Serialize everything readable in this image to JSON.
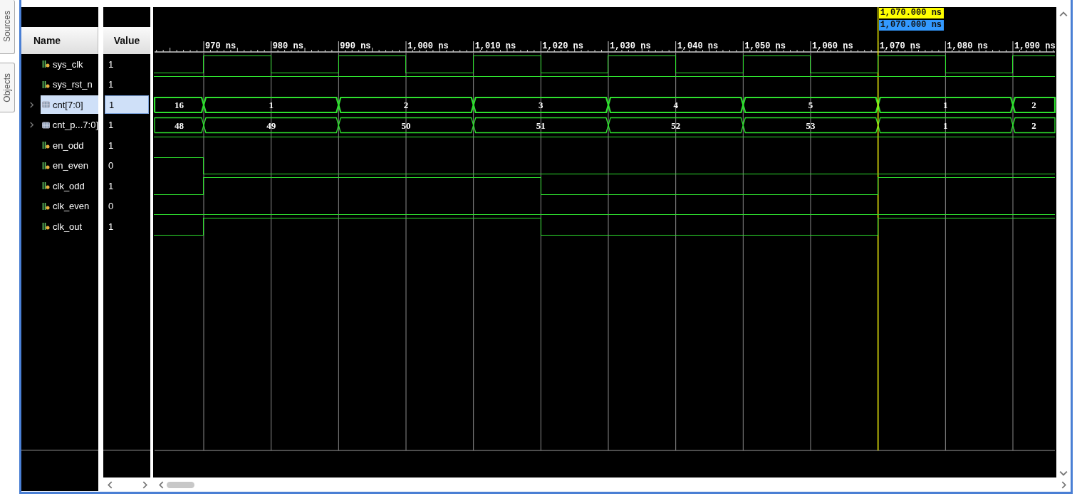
{
  "side_tabs": [
    {
      "label": "Sources"
    },
    {
      "label": "Objects"
    }
  ],
  "columns": {
    "name": "Name",
    "value": "Value"
  },
  "cursor": {
    "labels": [
      "1,070.000 ns",
      "1,070.000 ns"
    ]
  },
  "ruler": {
    "ticks": [
      "970 ns",
      "980 ns",
      "990 ns",
      "1,000 ns",
      "1,010 ns",
      "1,020 ns",
      "1,030 ns",
      "1,040 ns",
      "1,050 ns",
      "1,060 ns",
      "1,070 ns",
      "1,080 ns",
      "1,090 ns"
    ]
  },
  "signals": [
    {
      "name": "sys_clk",
      "value": "1",
      "kind": "bit",
      "selected": false,
      "wave": [
        {
          "high": false
        },
        {
          "high": true
        },
        {
          "high": false
        },
        {
          "high": true
        },
        {
          "high": false
        },
        {
          "high": true
        },
        {
          "high": false
        },
        {
          "high": true
        },
        {
          "high": false
        },
        {
          "high": true
        },
        {
          "high": false
        },
        {
          "high": true
        },
        {
          "high": false
        },
        {
          "high": true
        }
      ]
    },
    {
      "name": "sys_rst_n",
      "value": "1",
      "kind": "bit",
      "selected": false,
      "wave": [
        {
          "high": true
        },
        {
          "high": true
        },
        {
          "high": true
        },
        {
          "high": true
        },
        {
          "high": true
        },
        {
          "high": true
        },
        {
          "high": true
        },
        {
          "high": true
        },
        {
          "high": true
        },
        {
          "high": true
        },
        {
          "high": true
        },
        {
          "high": true
        },
        {
          "high": true
        },
        {
          "high": true
        }
      ]
    },
    {
      "name": "cnt[7:0]",
      "value": "1",
      "kind": "bus",
      "selected": true,
      "expanded": false,
      "wave": [
        {
          "value": "16"
        },
        {
          "value": "1"
        },
        {
          "continues": true
        },
        {
          "value": "2"
        },
        {
          "continues": true
        },
        {
          "value": "3"
        },
        {
          "continues": true
        },
        {
          "value": "4"
        },
        {
          "continues": true
        },
        {
          "value": "5"
        },
        {
          "continues": true
        },
        {
          "value": "1"
        },
        {
          "continues": true
        },
        {
          "value": "2"
        }
      ]
    },
    {
      "name": "cnt_p...7:0]",
      "value": "1",
      "kind": "bus",
      "selected": false,
      "expanded": false,
      "wave": [
        {
          "value": "48"
        },
        {
          "value": "49"
        },
        {
          "continues": true
        },
        {
          "value": "50"
        },
        {
          "continues": true
        },
        {
          "value": "51"
        },
        {
          "continues": true
        },
        {
          "value": "52"
        },
        {
          "continues": true
        },
        {
          "value": "53"
        },
        {
          "continues": true
        },
        {
          "value": "1"
        },
        {
          "continues": true
        },
        {
          "value": "2"
        }
      ]
    },
    {
      "name": "en_odd",
      "value": "1",
      "kind": "bit",
      "selected": false,
      "wave": [
        {
          "high": true
        },
        {
          "high": true
        },
        {
          "high": true
        },
        {
          "high": true
        },
        {
          "high": true
        },
        {
          "high": true
        },
        {
          "high": true
        },
        {
          "high": true
        },
        {
          "high": true
        },
        {
          "high": true
        },
        {
          "high": true
        },
        {
          "high": true
        },
        {
          "high": true
        },
        {
          "high": true
        }
      ]
    },
    {
      "name": "en_even",
      "value": "0",
      "kind": "bit",
      "selected": false,
      "wave": [
        {
          "high": true
        },
        {
          "high": false
        },
        {
          "high": false
        },
        {
          "high": false
        },
        {
          "high": false
        },
        {
          "high": false
        },
        {
          "high": false
        },
        {
          "high": false
        },
        {
          "high": false
        },
        {
          "high": false
        },
        {
          "high": false
        },
        {
          "high": false
        },
        {
          "high": false
        },
        {
          "high": false
        }
      ]
    },
    {
      "name": "clk_odd",
      "value": "1",
      "kind": "bit",
      "selected": false,
      "wave": [
        {
          "high": false
        },
        {
          "high": true
        },
        {
          "high": true
        },
        {
          "high": true
        },
        {
          "high": true
        },
        {
          "high": true
        },
        {
          "high": false
        },
        {
          "high": false
        },
        {
          "high": false
        },
        {
          "high": false
        },
        {
          "high": false
        },
        {
          "high": true
        },
        {
          "high": true
        },
        {
          "high": true
        }
      ]
    },
    {
      "name": "clk_even",
      "value": "0",
      "kind": "bit",
      "selected": false,
      "wave": [
        {
          "high": false
        },
        {
          "high": false
        },
        {
          "high": false
        },
        {
          "high": false
        },
        {
          "high": false
        },
        {
          "high": false
        },
        {
          "high": false
        },
        {
          "high": false
        },
        {
          "high": false
        },
        {
          "high": false
        },
        {
          "high": false
        },
        {
          "high": false
        },
        {
          "high": false
        },
        {
          "high": false
        }
      ]
    },
    {
      "name": "clk_out",
      "value": "1",
      "kind": "bit",
      "selected": false,
      "wave": [
        {
          "high": false
        },
        {
          "high": true
        },
        {
          "high": true
        },
        {
          "high": true
        },
        {
          "high": true
        },
        {
          "high": true
        },
        {
          "high": false
        },
        {
          "high": false
        },
        {
          "high": false
        },
        {
          "high": false
        },
        {
          "high": false
        },
        {
          "high": true
        },
        {
          "high": true
        },
        {
          "high": true
        }
      ]
    }
  ]
}
